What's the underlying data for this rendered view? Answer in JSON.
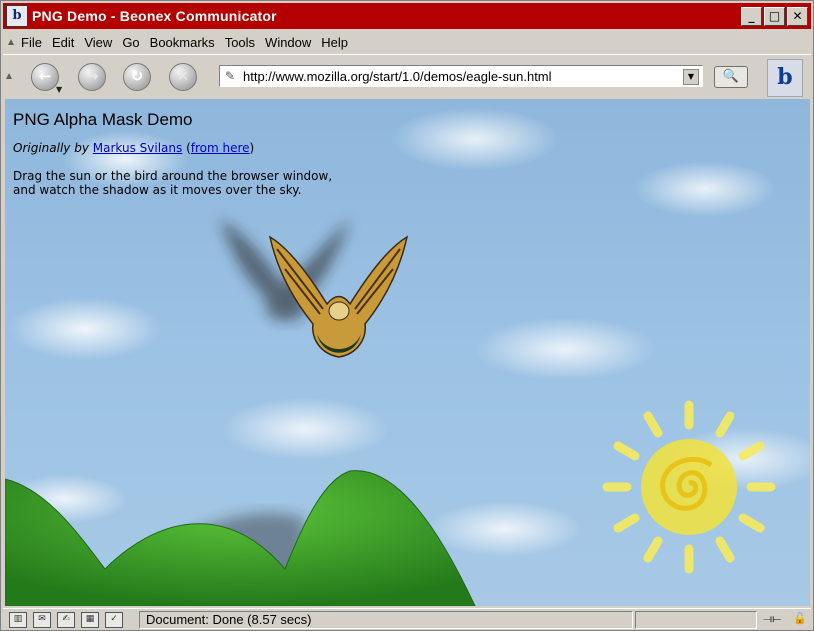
{
  "window": {
    "title": "PNG Demo - Beonex Communicator",
    "buttons": {
      "minimize": "_",
      "maximize": "□",
      "close": "✕"
    },
    "app_icon_letter": "b"
  },
  "menu": {
    "items": [
      {
        "label": "File"
      },
      {
        "label": "Edit"
      },
      {
        "label": "View"
      },
      {
        "label": "Go"
      },
      {
        "label": "Bookmarks"
      },
      {
        "label": "Tools"
      },
      {
        "label": "Window"
      },
      {
        "label": "Help"
      }
    ]
  },
  "nav": {
    "url": "http://www.mozilla.org/start/1.0/demos/eagle-sun.html",
    "back_glyph": "←",
    "forward_glyph": "→",
    "reload_glyph": "↻",
    "stop_glyph": "✕",
    "search_glyph": "🔍",
    "brand_letters": "b"
  },
  "page": {
    "title": "PNG Alpha Mask Demo",
    "byline_prefix": "Originally by",
    "author_link": "Markus Svilans",
    "source_link": "from here",
    "instructions_line1": "Drag the sun or the bird around the browser window,",
    "instructions_line2": "and watch the shadow as it moves over the sky."
  },
  "status": {
    "text": "Document: Done (8.57 secs)"
  },
  "colors": {
    "titlebar": "#b50000",
    "sky": "#9cc2e4",
    "hill": "#3c9a2a",
    "sun": "#f2e23a",
    "link": "#0000cc"
  }
}
